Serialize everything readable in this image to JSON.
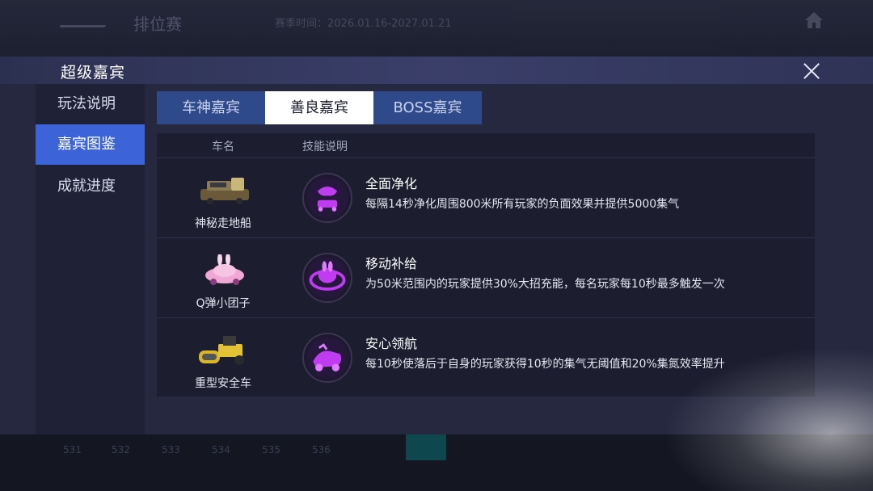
{
  "background": {
    "rank_title": "排位赛",
    "season": "赛季时间：2026.01.16-2027.01.21",
    "bottom_numbers": [
      "531",
      "532",
      "533",
      "534",
      "535",
      "536"
    ]
  },
  "modal": {
    "title": "超级嘉宾",
    "sidebar": [
      {
        "label": "玩法说明",
        "active": false
      },
      {
        "label": "嘉宾图鉴",
        "active": true
      },
      {
        "label": "成就进度",
        "active": false
      }
    ],
    "tabs": [
      {
        "label": "车神嘉宾",
        "active": false
      },
      {
        "label": "善良嘉宾",
        "active": true
      },
      {
        "label": "BOSS嘉宾",
        "active": false
      }
    ],
    "table": {
      "headers": {
        "car": "车名",
        "skill": "技能说明"
      },
      "rows": [
        {
          "car_name": "神秘走地船",
          "skill_title": "全面净化",
          "skill_desc": "每隔14秒净化周围800米所有玩家的负面效果并提供5000集气"
        },
        {
          "car_name": "Q弹小团子",
          "skill_title": "移动补给",
          "skill_desc": "为50米范围内的玩家提供30%大招充能，每名玩家每10秒最多触发一次"
        },
        {
          "car_name": "重型安全车",
          "skill_title": "安心领航",
          "skill_desc": "每10秒使落后于自身的玩家获得10秒的集气无阈值和20%集氮效率提升"
        }
      ]
    }
  },
  "colors": {
    "accent_blue": "#3d63d9",
    "tab_inactive": "#2f4a8a",
    "skill_purple": "#c03cf0"
  },
  "icons": [
    "close-icon",
    "home-icon",
    "info-icon",
    "boat-car-icon",
    "bunny-car-icon",
    "roller-car-icon",
    "purify-skill-icon",
    "supply-skill-icon",
    "guide-skill-icon"
  ]
}
